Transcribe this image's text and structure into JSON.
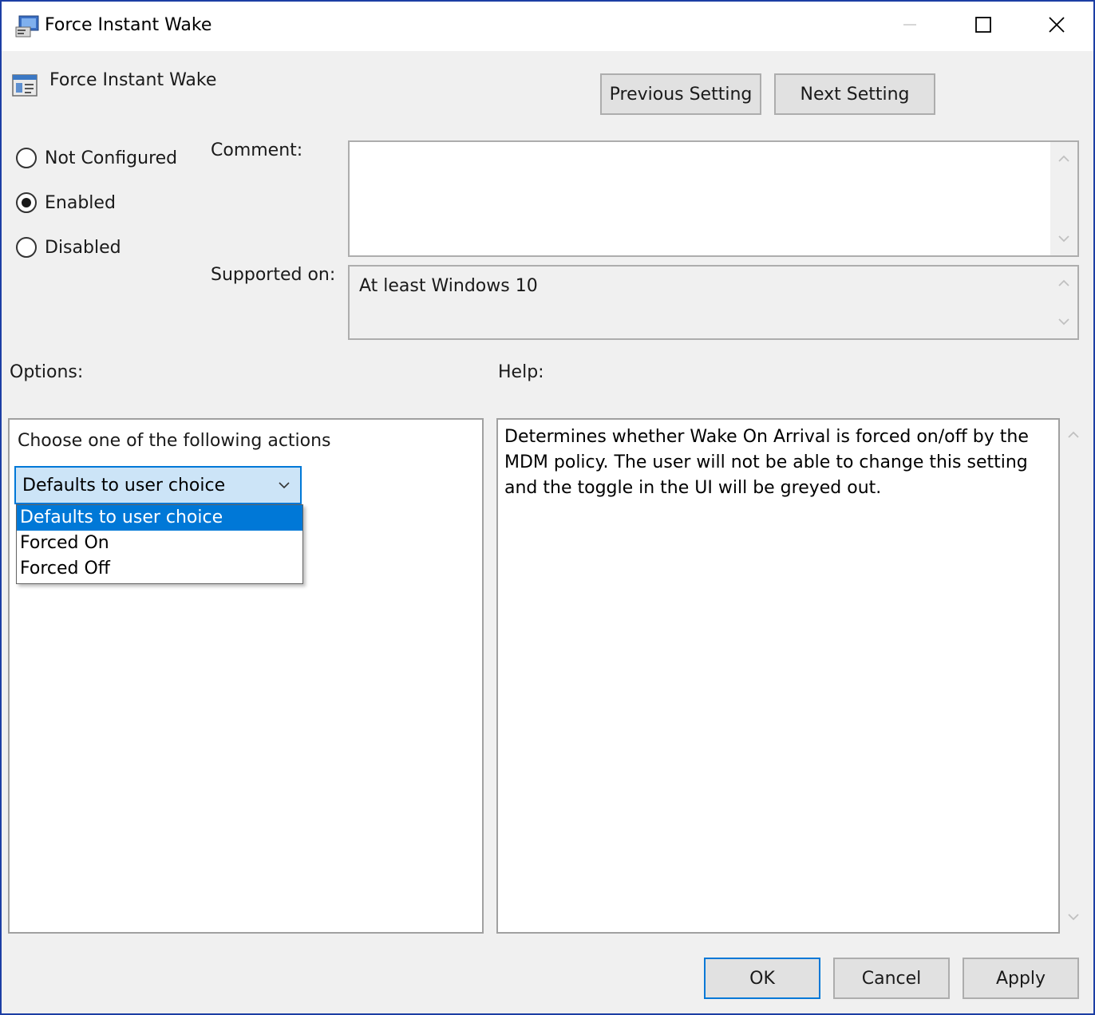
{
  "window": {
    "title": "Force Instant Wake",
    "setting_name": "Force Instant Wake",
    "colors": {
      "border": "#1c3ea4",
      "accent": "#0078d7",
      "selection_bg": "#cce4f7"
    }
  },
  "nav": {
    "previous_label": "Previous Setting",
    "next_label": "Next Setting"
  },
  "state": {
    "options": [
      {
        "label": "Not Configured",
        "checked": false
      },
      {
        "label": "Enabled",
        "checked": true
      },
      {
        "label": "Disabled",
        "checked": false
      }
    ]
  },
  "comment": {
    "label": "Comment:",
    "value": ""
  },
  "supported": {
    "label": "Supported on:",
    "value": "At least Windows 10"
  },
  "options_section": {
    "label": "Options:",
    "instruction": "Choose one of the following actions",
    "combo_value": "Defaults to user choice",
    "dropdown_items": [
      "Defaults to user choice",
      "Forced On",
      "Forced Off"
    ],
    "selected_index": 0
  },
  "help": {
    "label": "Help:",
    "text": "Determines whether Wake On Arrival is forced on/off by the MDM policy. The user will not be able to change this setting and the toggle in the UI will be greyed out."
  },
  "footer": {
    "ok_label": "OK",
    "cancel_label": "Cancel",
    "apply_label": "Apply"
  },
  "icons": {
    "title": "policy-window-icon",
    "setting": "policy-setting-icon",
    "minimize": "minimize-icon",
    "maximize": "maximize-icon",
    "close": "close-icon",
    "scroll_up": "chevron-up-icon",
    "scroll_down": "chevron-down-icon",
    "combo_arrow": "chevron-down-icon"
  }
}
